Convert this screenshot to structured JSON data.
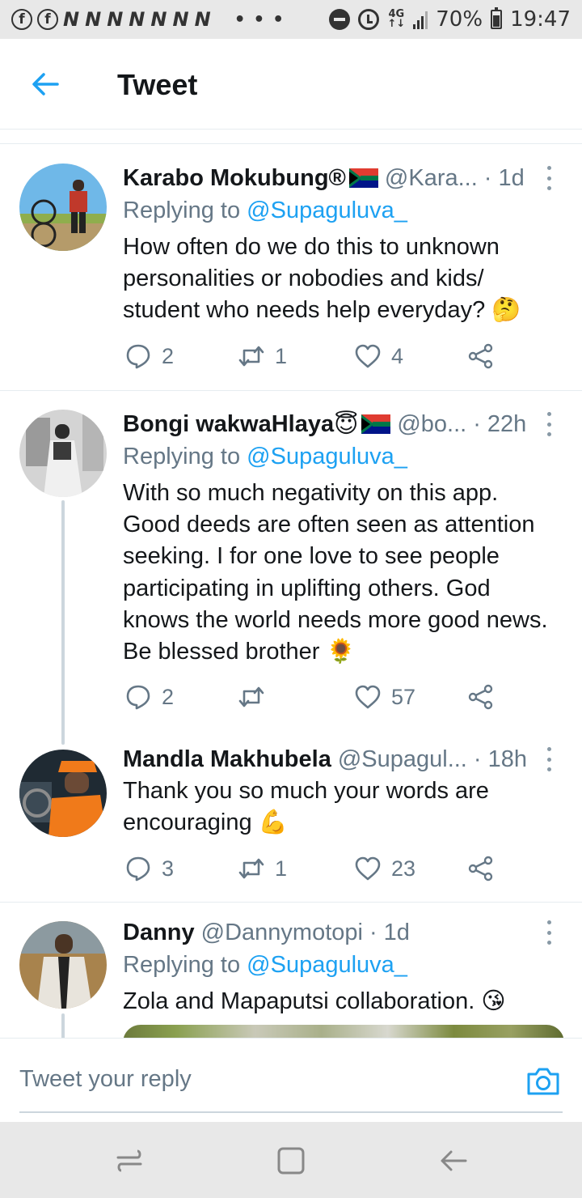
{
  "status_bar": {
    "left_icons": [
      "facebook-icon",
      "facebook-icon",
      "n-icon",
      "n-icon",
      "n-icon",
      "n-icon",
      "n-icon",
      "n-icon",
      "n-icon"
    ],
    "n_glyph": "N",
    "fb_glyph": "f",
    "overflow": "• • •",
    "network_top": "4G",
    "network_bottom": "↑↓",
    "battery": "70%",
    "time": "19:47"
  },
  "header": {
    "title": "Tweet"
  },
  "colors": {
    "accent": "#1da1f2",
    "text": "#14171a",
    "muted": "#657786",
    "divider": "#e6ecf0"
  },
  "tweets": [
    {
      "name": "Karabo Mokubung",
      "name_suffix": "®",
      "has_flag": true,
      "handle": "@Kara...",
      "time": "· 1d",
      "reply_prefix": "Replying to",
      "reply_to": "@Supaguluva_",
      "lines": [
        "How often do we do this to unknown",
        "personalities or nobodies and kids/",
        "student who needs help everyday? 🤔"
      ],
      "replies": "2",
      "retweets": "1",
      "likes": "4"
    },
    {
      "name": "Bongi wakwaHlaya",
      "name_suffix": "😇",
      "has_flag": true,
      "handle": "@bo...",
      "time": "· 22h",
      "reply_prefix": "Replying to",
      "reply_to": "@Supaguluva_",
      "lines": [
        "With so much negativity on this app.",
        "Good deeds are often seen as attention",
        "seeking. I for one love to see people",
        "participating in uplifting others. God",
        "knows the world needs more good news.",
        "Be blessed brother 🌻"
      ],
      "replies": "2",
      "retweets": "",
      "likes": "57"
    },
    {
      "name": "Mandla Makhubela",
      "handle": "@Supagul...",
      "time": "· 18h",
      "lines": [
        "Thank you so much your words are",
        "encouraging 💪"
      ],
      "replies": "3",
      "retweets": "1",
      "likes": "23"
    },
    {
      "name": "Danny",
      "handle": "@Dannymotopi",
      "time": "· 1d",
      "reply_prefix": "Replying to",
      "reply_to": "@Supaguluva_",
      "lines": [
        "Zola and Mapaputsi collaboration. 😘"
      ]
    }
  ],
  "composer": {
    "placeholder": "Tweet your reply"
  }
}
